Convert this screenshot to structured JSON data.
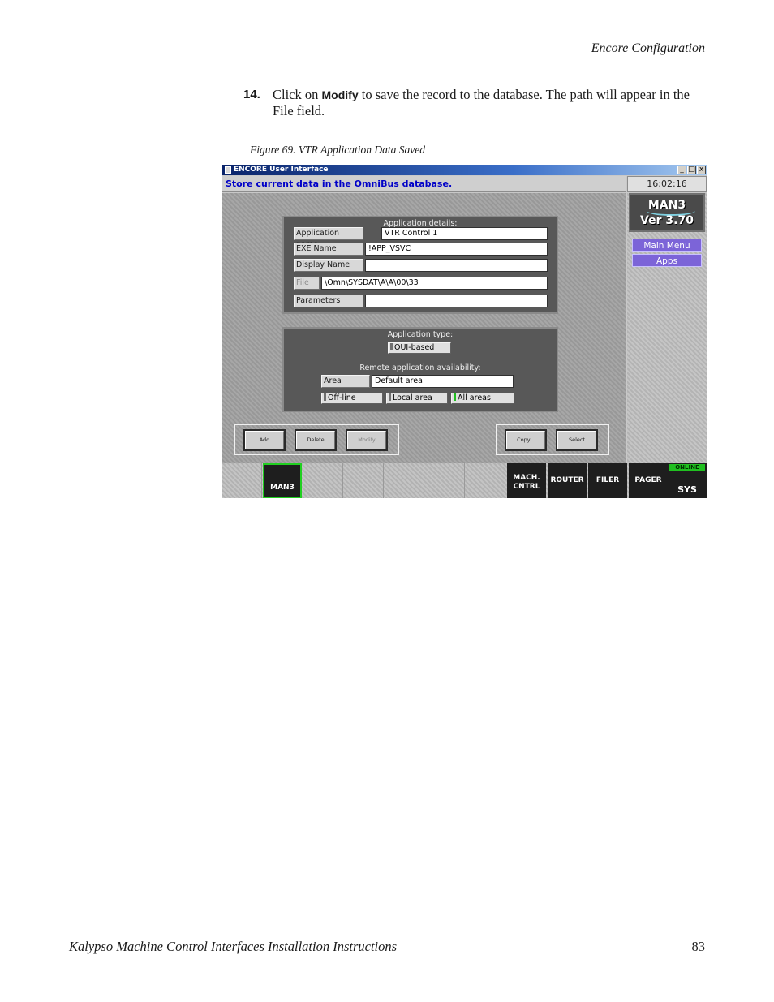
{
  "header": {
    "section": "Encore Configuration"
  },
  "step": {
    "number": "14.",
    "text_before": "Click on ",
    "keyword": "Modify",
    "text_after": " to save the record to the database. The path will appear in the File field."
  },
  "figure": {
    "caption": "Figure 69.  VTR Application Data Saved"
  },
  "window": {
    "title": "ENCORE User Interface",
    "controls": [
      "_",
      "□",
      "x"
    ],
    "status_message": "Store current data in the OmniBus database.",
    "clock": "16:02:16",
    "logo": {
      "line1": "MAN3",
      "line2": "Ver 3.70"
    },
    "sidebar_buttons": [
      "Main Menu",
      "Apps"
    ],
    "app_details": {
      "title": "Application details:",
      "fields": [
        {
          "label": "Application name",
          "value": "VTR Control 1"
        },
        {
          "label": "EXE Name",
          "value": "!APP_VSVC"
        },
        {
          "label": "Display Name",
          "value": ""
        },
        {
          "label": "File",
          "value": "\\Omn\\SYSDAT\\A\\A\\00\\33"
        },
        {
          "label": "Parameters",
          "value": ""
        }
      ]
    },
    "app_type": {
      "title": "Application type:",
      "type_option": "OUI-based",
      "remote_title": "Remote application availability:",
      "area_label": "Area",
      "area_value": "Default area",
      "options": [
        {
          "label": "Off-line",
          "selected": false
        },
        {
          "label": "Local area",
          "selected": false
        },
        {
          "label": "All areas",
          "selected": true
        }
      ]
    },
    "action_buttons": [
      "Add",
      "Delete",
      "Modify"
    ],
    "right_buttons": [
      "Copy...",
      "Select"
    ],
    "bottom_nav": {
      "active": "MAN3",
      "items": [
        "MACH.\nCNTRL",
        "ROUTER",
        "FILER",
        "PAGER",
        "SYS"
      ],
      "online_label": "ONLINE"
    }
  },
  "footer": {
    "title": "Kalypso Machine Control Interfaces Installation Instructions",
    "page": "83"
  }
}
